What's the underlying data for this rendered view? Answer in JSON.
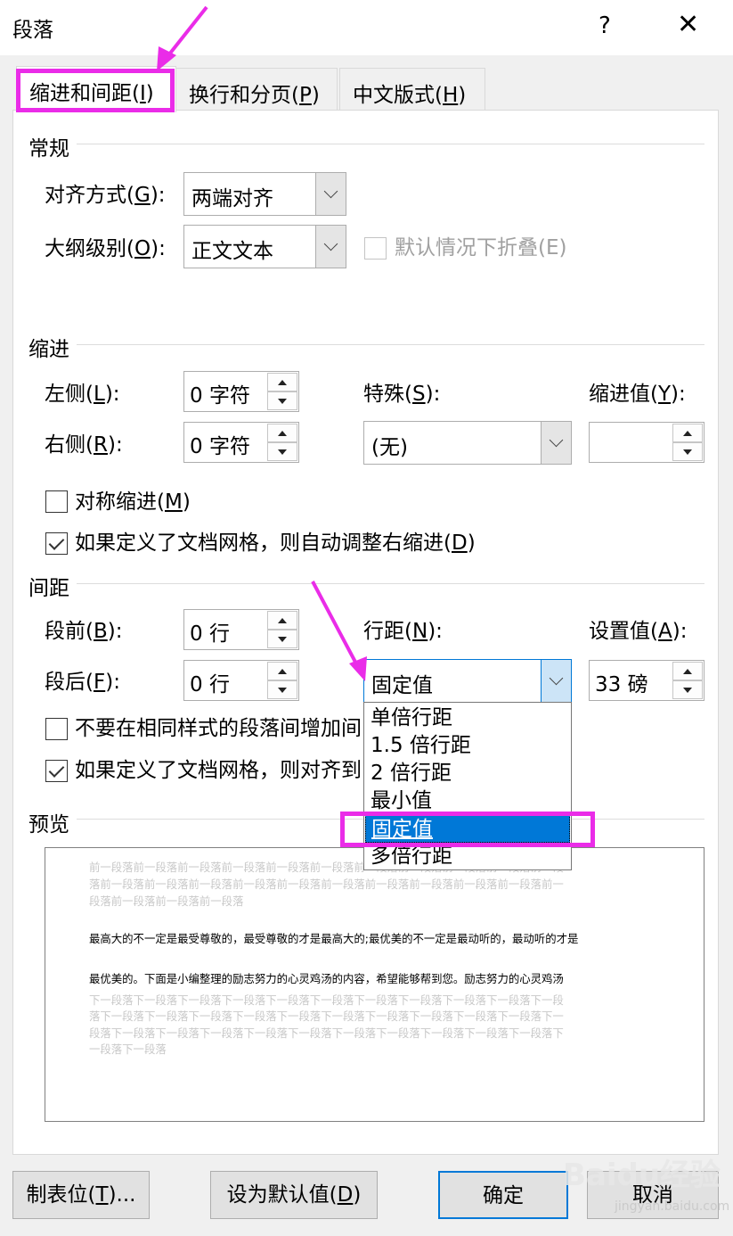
{
  "window": {
    "title": "段落",
    "help": "?",
    "close": "✕"
  },
  "tabs": [
    {
      "label": "缩进和间距(",
      "key": "I",
      "tail": ")"
    },
    {
      "label": "换行和分页(",
      "key": "P",
      "tail": ")"
    },
    {
      "label": "中文版式(",
      "key": "H",
      "tail": ")"
    }
  ],
  "general": {
    "heading": "常规",
    "align_label": "对齐方式(",
    "align_key": "G",
    "align_tail": "):",
    "align_value": "两端对齐",
    "outline_label": "大纲级别(",
    "outline_key": "O",
    "outline_tail": "):",
    "outline_value": "正文文本",
    "collapse_label": "默认情况下折叠(E)"
  },
  "indent": {
    "heading": "缩进",
    "left_label": "左侧(",
    "left_key": "L",
    "left_tail": "):",
    "left_value": "0 字符",
    "right_label": "右侧(",
    "right_key": "R",
    "right_tail": "):",
    "right_value": "0 字符",
    "special_label": "特殊(",
    "special_key": "S",
    "special_tail": "):",
    "special_value": "(无)",
    "by_label": "缩进值(",
    "by_key": "Y",
    "by_tail": "):",
    "by_value": "",
    "mirror_label": "对称缩进(",
    "mirror_key": "M",
    "mirror_tail": ")",
    "mirror_checked": false,
    "auto_right_label": "如果定义了文档网格，则自动调整右缩进(",
    "auto_right_key": "D",
    "auto_right_tail": ")",
    "auto_right_checked": true
  },
  "spacing": {
    "heading": "间距",
    "before_label": "段前(",
    "before_key": "B",
    "before_tail": "):",
    "before_value": "0 行",
    "after_label": "段后(",
    "after_key": "F",
    "after_tail": "):",
    "after_value": "0 行",
    "line_label": "行距(",
    "line_key": "N",
    "line_tail": "):",
    "line_value": "固定值",
    "at_label": "设置值(",
    "at_key": "A",
    "at_tail": "):",
    "at_value": "33 磅",
    "no_space_label": "不要在相同样式的段落间增加间",
    "no_space_checked": false,
    "snap_label": "如果定义了文档网格，则对齐到",
    "snap_checked": true
  },
  "line_spacing_options": [
    "单倍行距",
    "1.5 倍行距",
    "2 倍行距",
    "最小值",
    "固定值",
    "多倍行距"
  ],
  "line_spacing_selected": "固定值",
  "preview": {
    "heading": "预览",
    "prev_lines": [
      "前一段落前一段落前一段落前一段落前一段落前一段落前一段落前一段落前一段落前一段落前一段",
      "落前一段落前一段落前一段落前一段落前一段落前一段落前一段落前一段落前一段落前一段落前一",
      "段落前一段落前一段落前一段落"
    ],
    "sample_line1": "最高大的不一定是最受尊敬的，最受尊敬的才是最高大的;最优美的不一定是最动听的，最动听的才是",
    "sample_line2": "最优美的。下面是小编整理的励志努力的心灵鸡汤的内容，希望能够帮到您。励志努力的心灵鸡汤",
    "next_lines": [
      "下一段落下一段落下一段落下一段落下一段落下一段落下一段落下一段落下一段落下一段落下一段",
      "落下一段落下一段落下一段落下一段落下一段落下一段落下一段落下一段落下一段落下一段落下一",
      "段落下一段落下一段落下一段落下一段落下一段落下一段落下一段落下一段落下一段落下一段落下",
      "一段落下一段落"
    ]
  },
  "footer": {
    "tabs_btn": "制表位(",
    "tabs_key": "T",
    "tabs_tail": ")...",
    "default_btn": "设为默认值(",
    "default_key": "D",
    "default_tail": ")",
    "ok_btn": "确定",
    "cancel_btn": "取消"
  },
  "watermark": {
    "logo": "Baidu经验",
    "url": "jingyan.baidu.com"
  },
  "colors": {
    "highlight": "#ea2ce8",
    "selection": "#0078d7"
  }
}
